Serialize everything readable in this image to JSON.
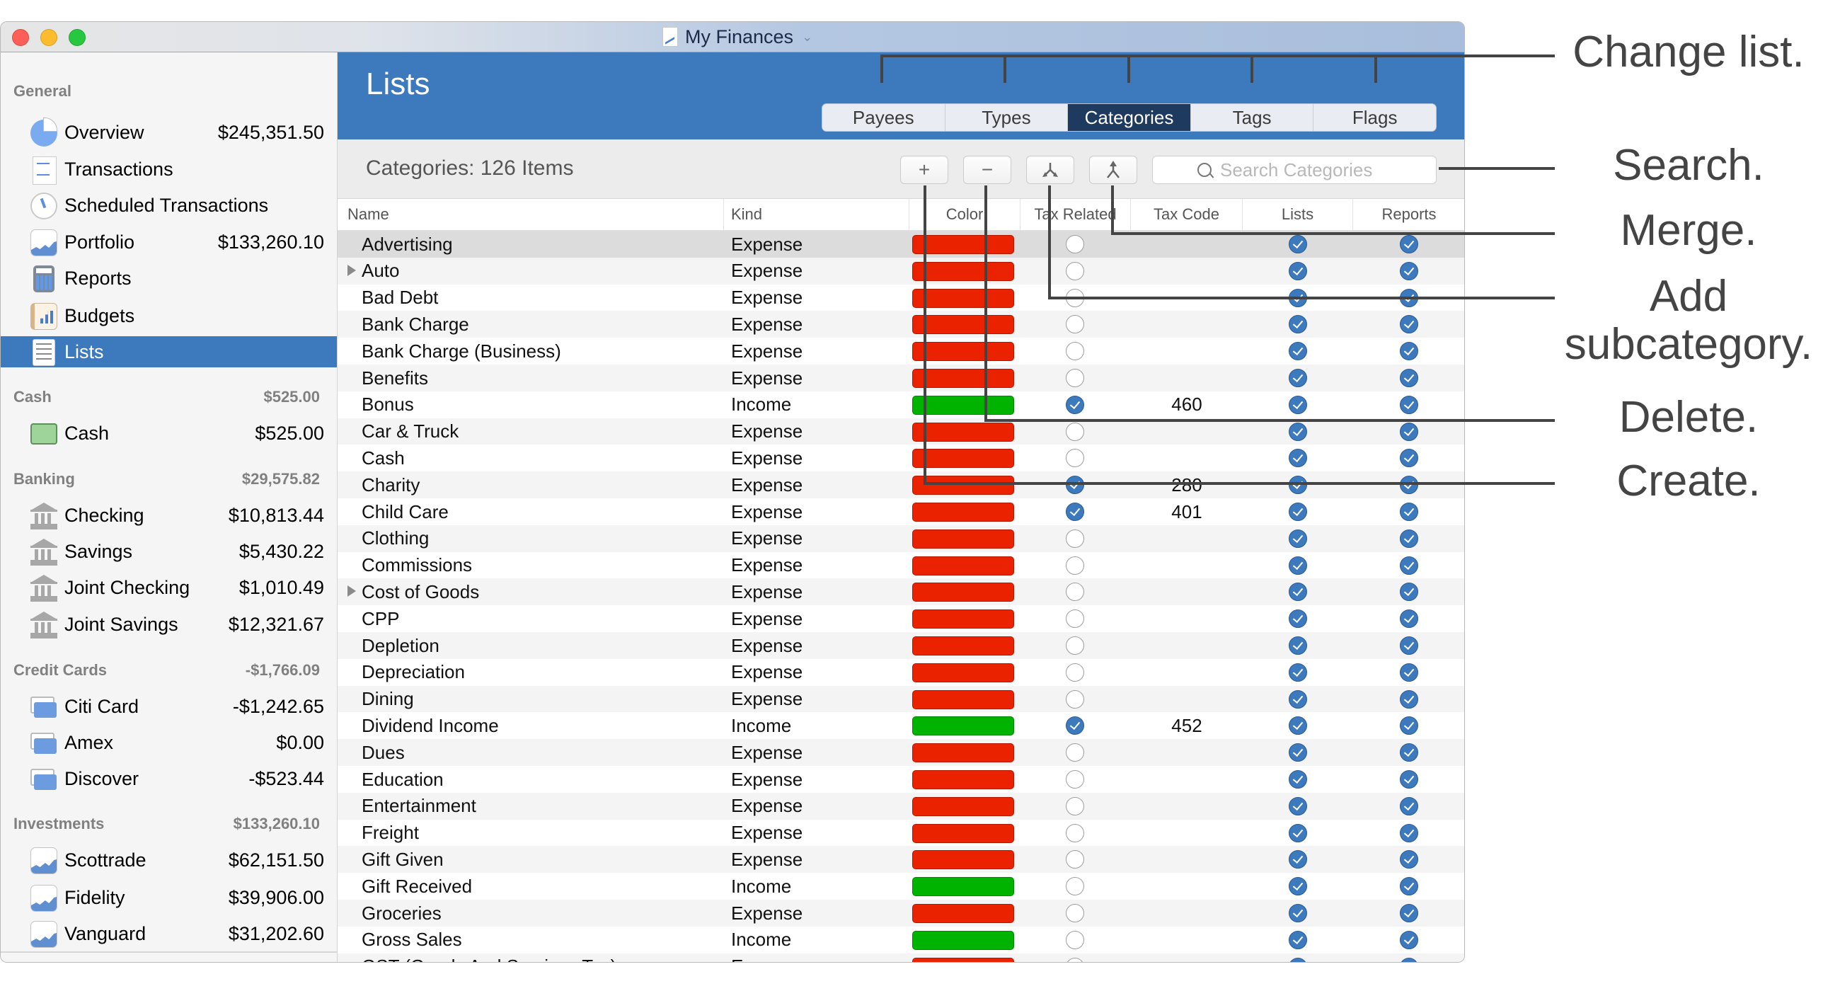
{
  "window": {
    "title": "My Finances",
    "title_icon": "finance-document-icon",
    "title_chevron": "chevron-down-icon"
  },
  "sidebar": {
    "sections": [
      {
        "label": "General",
        "total": "",
        "items": [
          {
            "label": "Overview",
            "amount": "$245,351.50",
            "icon": "pie-chart-icon"
          },
          {
            "label": "Transactions",
            "amount": "",
            "icon": "receipt-icon"
          },
          {
            "label": "Scheduled Transactions",
            "amount": "",
            "icon": "clock-icon"
          },
          {
            "label": "Portfolio",
            "amount": "$133,260.10",
            "icon": "stock-chart-icon"
          },
          {
            "label": "Reports",
            "amount": "",
            "icon": "calculator-icon"
          },
          {
            "label": "Budgets",
            "amount": "",
            "icon": "budget-book-icon"
          },
          {
            "label": "Lists",
            "amount": "",
            "icon": "list-icon",
            "selected": true
          }
        ]
      },
      {
        "label": "Cash",
        "total": "$525.00",
        "items": [
          {
            "label": "Cash",
            "amount": "$525.00",
            "icon": "cash-icon"
          }
        ]
      },
      {
        "label": "Banking",
        "total": "$29,575.82",
        "items": [
          {
            "label": "Checking",
            "amount": "$10,813.44",
            "icon": "bank-icon"
          },
          {
            "label": "Savings",
            "amount": "$5,430.22",
            "icon": "bank-icon"
          },
          {
            "label": "Joint Checking",
            "amount": "$1,010.49",
            "icon": "bank-icon"
          },
          {
            "label": "Joint Savings",
            "amount": "$12,321.67",
            "icon": "bank-icon"
          }
        ]
      },
      {
        "label": "Credit Cards",
        "total": "-$1,766.09",
        "items": [
          {
            "label": "Citi Card",
            "amount": "-$1,242.65",
            "icon": "credit-card-icon"
          },
          {
            "label": "Amex",
            "amount": "$0.00",
            "icon": "credit-card-icon"
          },
          {
            "label": "Discover",
            "amount": "-$523.44",
            "icon": "credit-card-icon"
          }
        ]
      },
      {
        "label": "Investments",
        "total": "$133,260.10",
        "items": [
          {
            "label": "Scottrade",
            "amount": "$62,151.50",
            "icon": "stock-chart-icon"
          },
          {
            "label": "Fidelity",
            "amount": "$39,906.00",
            "icon": "stock-chart-icon"
          },
          {
            "label": "Vanguard",
            "amount": "$31,202.60",
            "icon": "stock-chart-icon"
          }
        ]
      }
    ],
    "footer": {
      "add": "+",
      "collapse": "^",
      "refresh": "↻"
    }
  },
  "main": {
    "title": "Lists",
    "tabs": [
      {
        "label": "Payees",
        "active": false
      },
      {
        "label": "Types",
        "active": false
      },
      {
        "label": "Categories",
        "active": true
      },
      {
        "label": "Tags",
        "active": false
      },
      {
        "label": "Flags",
        "active": false
      }
    ],
    "count_label": "Categories: 126 Items",
    "toolbar": {
      "create": "+",
      "delete": "−",
      "add_subcategory": "⅄",
      "merge": "⅄"
    },
    "search": {
      "placeholder": "Search Categories",
      "value": ""
    },
    "columns": [
      "Name",
      "Kind",
      "Color",
      "Tax Related",
      "Tax Code",
      "Lists",
      "Reports"
    ],
    "colors": {
      "expense": "#eb2200",
      "income": "#00b300",
      "accent": "#3d79bd",
      "selected_tab": "#1e3a5e"
    },
    "rows": [
      {
        "name": "Advertising",
        "kind": "Expense",
        "color": "expense",
        "tax_related": false,
        "tax_code": "",
        "lists": true,
        "reports": true,
        "expandable": false,
        "selected": true
      },
      {
        "name": "Auto",
        "kind": "Expense",
        "color": "expense",
        "tax_related": false,
        "tax_code": "",
        "lists": true,
        "reports": true,
        "expandable": true
      },
      {
        "name": "Bad Debt",
        "kind": "Expense",
        "color": "expense",
        "tax_related": false,
        "tax_code": "",
        "lists": true,
        "reports": true
      },
      {
        "name": "Bank Charge",
        "kind": "Expense",
        "color": "expense",
        "tax_related": false,
        "tax_code": "",
        "lists": true,
        "reports": true
      },
      {
        "name": "Bank Charge (Business)",
        "kind": "Expense",
        "color": "expense",
        "tax_related": false,
        "tax_code": "",
        "lists": true,
        "reports": true
      },
      {
        "name": "Benefits",
        "kind": "Expense",
        "color": "expense",
        "tax_related": false,
        "tax_code": "",
        "lists": true,
        "reports": true
      },
      {
        "name": "Bonus",
        "kind": "Income",
        "color": "income",
        "tax_related": true,
        "tax_code": "460",
        "lists": true,
        "reports": true
      },
      {
        "name": "Car & Truck",
        "kind": "Expense",
        "color": "expense",
        "tax_related": false,
        "tax_code": "",
        "lists": true,
        "reports": true
      },
      {
        "name": "Cash",
        "kind": "Expense",
        "color": "expense",
        "tax_related": false,
        "tax_code": "",
        "lists": true,
        "reports": true
      },
      {
        "name": "Charity",
        "kind": "Expense",
        "color": "expense",
        "tax_related": true,
        "tax_code": "280",
        "lists": true,
        "reports": true
      },
      {
        "name": "Child Care",
        "kind": "Expense",
        "color": "expense",
        "tax_related": true,
        "tax_code": "401",
        "lists": true,
        "reports": true
      },
      {
        "name": "Clothing",
        "kind": "Expense",
        "color": "expense",
        "tax_related": false,
        "tax_code": "",
        "lists": true,
        "reports": true
      },
      {
        "name": "Commissions",
        "kind": "Expense",
        "color": "expense",
        "tax_related": false,
        "tax_code": "",
        "lists": true,
        "reports": true
      },
      {
        "name": "Cost of Goods",
        "kind": "Expense",
        "color": "expense",
        "tax_related": false,
        "tax_code": "",
        "lists": true,
        "reports": true,
        "expandable": true
      },
      {
        "name": "CPP",
        "kind": "Expense",
        "color": "expense",
        "tax_related": false,
        "tax_code": "",
        "lists": true,
        "reports": true
      },
      {
        "name": "Depletion",
        "kind": "Expense",
        "color": "expense",
        "tax_related": false,
        "tax_code": "",
        "lists": true,
        "reports": true
      },
      {
        "name": "Depreciation",
        "kind": "Expense",
        "color": "expense",
        "tax_related": false,
        "tax_code": "",
        "lists": true,
        "reports": true
      },
      {
        "name": "Dining",
        "kind": "Expense",
        "color": "expense",
        "tax_related": false,
        "tax_code": "",
        "lists": true,
        "reports": true
      },
      {
        "name": "Dividend Income",
        "kind": "Income",
        "color": "income",
        "tax_related": true,
        "tax_code": "452",
        "lists": true,
        "reports": true
      },
      {
        "name": "Dues",
        "kind": "Expense",
        "color": "expense",
        "tax_related": false,
        "tax_code": "",
        "lists": true,
        "reports": true
      },
      {
        "name": "Education",
        "kind": "Expense",
        "color": "expense",
        "tax_related": false,
        "tax_code": "",
        "lists": true,
        "reports": true
      },
      {
        "name": "Entertainment",
        "kind": "Expense",
        "color": "expense",
        "tax_related": false,
        "tax_code": "",
        "lists": true,
        "reports": true
      },
      {
        "name": "Freight",
        "kind": "Expense",
        "color": "expense",
        "tax_related": false,
        "tax_code": "",
        "lists": true,
        "reports": true
      },
      {
        "name": "Gift Given",
        "kind": "Expense",
        "color": "expense",
        "tax_related": false,
        "tax_code": "",
        "lists": true,
        "reports": true
      },
      {
        "name": "Gift Received",
        "kind": "Income",
        "color": "income",
        "tax_related": false,
        "tax_code": "",
        "lists": true,
        "reports": true
      },
      {
        "name": "Groceries",
        "kind": "Expense",
        "color": "expense",
        "tax_related": false,
        "tax_code": "",
        "lists": true,
        "reports": true
      },
      {
        "name": "Gross Sales",
        "kind": "Income",
        "color": "income",
        "tax_related": false,
        "tax_code": "",
        "lists": true,
        "reports": true
      },
      {
        "name": "GST (Goods And Services Tax)",
        "kind": "Expense",
        "color": "expense",
        "tax_related": false,
        "tax_code": "",
        "lists": true,
        "reports": true
      }
    ]
  },
  "callouts": {
    "change_list": "Change list.",
    "search": "Search.",
    "merge": "Merge.",
    "add_subcategory": "Add subcategory.",
    "delete": "Delete.",
    "create": "Create."
  }
}
